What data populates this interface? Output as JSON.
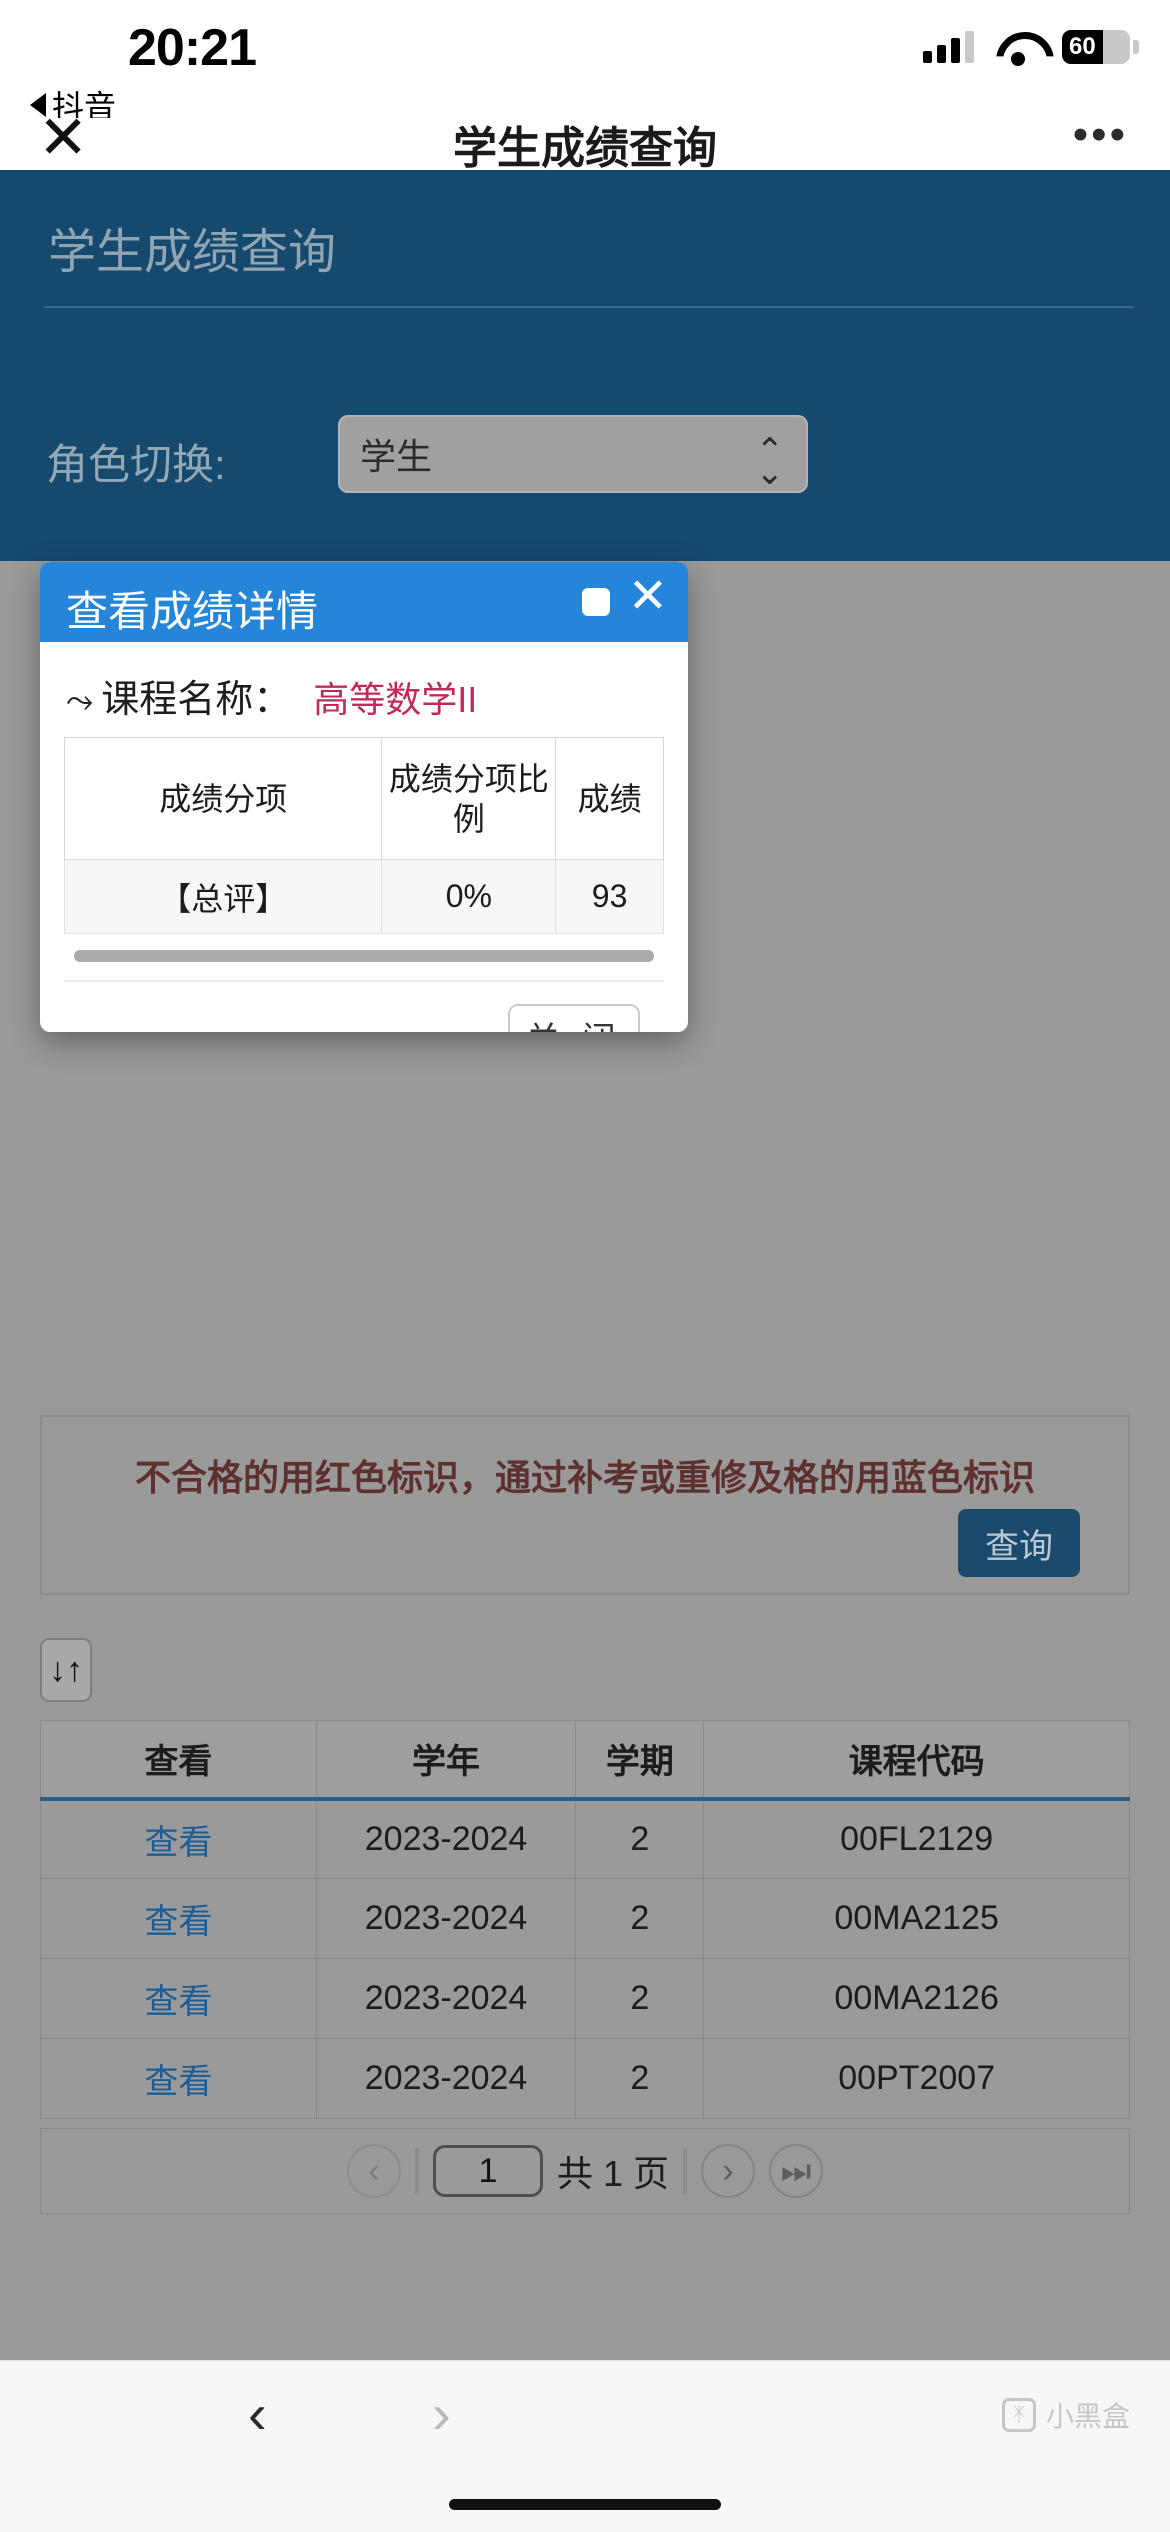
{
  "status_bar": {
    "time": "20:21",
    "back_app": "抖音",
    "battery_percent": "60",
    "icons": {
      "signal": "signal-bars-icon",
      "wifi": "wifi-icon",
      "battery": "battery-icon"
    }
  },
  "nav": {
    "close_icon": "✕",
    "title": "学生成绩查询",
    "more_icon": "•••"
  },
  "hero": {
    "title": "学生成绩查询"
  },
  "role": {
    "label": "角色切换:",
    "value": "学生",
    "options": [
      "学生"
    ]
  },
  "modal": {
    "title": "查看成绩详情",
    "maximize_icon": "maximize-icon",
    "close_icon": "✕",
    "course": {
      "arrow": "⤳",
      "label": "课程名称：",
      "value": "高等数学II",
      "value_color": "#c02a5a"
    },
    "table": {
      "headers": [
        "成绩分项",
        "成绩分项比例",
        "成绩"
      ],
      "rows": [
        [
          "【总评】",
          "0%",
          "93"
        ]
      ]
    },
    "close_button": "关 闭"
  },
  "note": {
    "text": "不合格的用红色标识，通过补考或重修及格的用蓝色标识",
    "text_color": "#5e3030",
    "query_button": "查询"
  },
  "sort_button": {
    "icon": "↓↑"
  },
  "results": {
    "headers": [
      "查看",
      "学年",
      "学期",
      "课程代码"
    ],
    "rows": [
      {
        "view": "查看",
        "year": "2023-2024",
        "term": "2",
        "code": "00FL2129"
      },
      {
        "view": "查看",
        "year": "2023-2024",
        "term": "2",
        "code": "00MA2125"
      },
      {
        "view": "查看",
        "year": "2023-2024",
        "term": "2",
        "code": "00MA2126"
      },
      {
        "view": "查看",
        "year": "2023-2024",
        "term": "2",
        "code": "00PT2007"
      }
    ]
  },
  "pagination": {
    "prev_icon": "‹",
    "page_value": "1",
    "total_text": "共 1 页",
    "next_icon": "›",
    "last_icon": "⏭"
  },
  "bottom_bar": {
    "back_icon": "‹",
    "forward_icon": "›",
    "watermark": "小黑盒"
  },
  "colors": {
    "hero_blue": "#16496e",
    "modal_blue": "#2585d8",
    "page_gray": "#9a9a9a",
    "link_blue": "#1d5d96"
  }
}
